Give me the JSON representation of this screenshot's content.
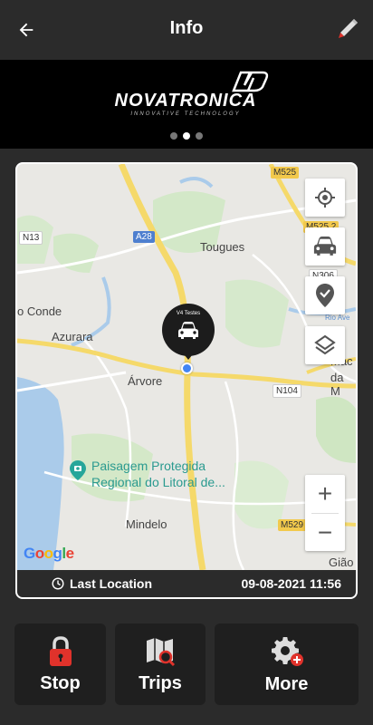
{
  "header": {
    "title": "Info",
    "back_icon": "arrow-left-icon",
    "edit_icon": "pencil-icon"
  },
  "banner": {
    "logo_text": "NOVATRONICA",
    "logo_tagline": "INNOVATIVE TECHNOLOGY",
    "carousel_pages": 3,
    "carousel_active": 2
  },
  "map": {
    "labels": {
      "tougues": "Tougues",
      "conde": "o Conde",
      "azurara": "Azurara",
      "arvore": "Árvore",
      "mindelo": "Mindelo",
      "giao": "Gião",
      "rio_ave": "Rio Ave",
      "mac": "Mac",
      "da_m": "da M"
    },
    "roads": {
      "m525": "M525",
      "m525b": "M525.2",
      "a28": "A28",
      "n13": "N13",
      "n306": "N306",
      "n104": "N104",
      "m529": "M529"
    },
    "poi_line1": "Paisagem Protegida",
    "poi_line2": "Regional do Litoral de...",
    "marker_label": "V4 Testes",
    "controls": {
      "locate_icon": "crosshair-icon",
      "vehicle_icon": "car-icon",
      "place_icon": "location-check-icon",
      "layers_icon": "layers-icon",
      "zoom_in": "+",
      "zoom_out": "−"
    },
    "attribution": "Google",
    "status_label": "Last Location",
    "status_datetime": "09-08-2021 11:56",
    "status_icon": "clock-icon"
  },
  "actions": [
    {
      "label": "Stop",
      "icon": "lock-icon"
    },
    {
      "label": "Trips",
      "icon": "map-search-icon"
    },
    {
      "label": "More",
      "icon": "gear-plus-icon"
    }
  ],
  "colors": {
    "background": "#2b2b2b",
    "banner": "#000000",
    "button": "#1f1f1f",
    "accent_red": "#e0322b",
    "location_blue": "#4285f4"
  }
}
